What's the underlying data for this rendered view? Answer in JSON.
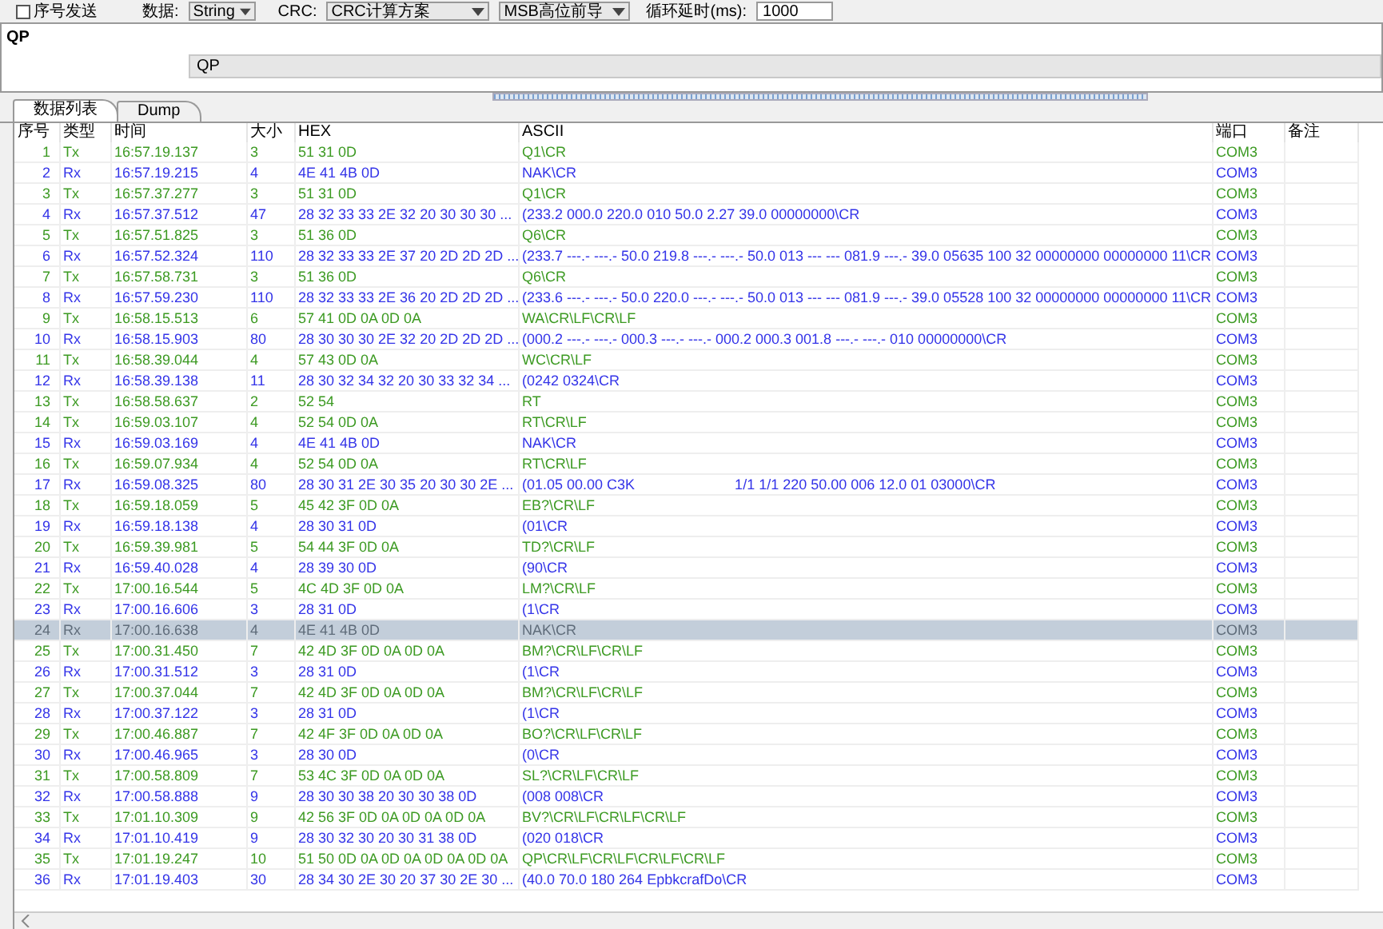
{
  "toolbar": {
    "sequence_send": {
      "label": "序号发送",
      "checked": false
    },
    "data_label": "数据:",
    "data_format": "String",
    "crc_label": "CRC:",
    "crc_scheme": "CRC计算方案",
    "bit_order": "MSB高位前导",
    "loop_delay_label": "循环延时(ms):",
    "loop_delay": "1000"
  },
  "send_panel": {
    "text": "QP",
    "history": "QP"
  },
  "tabs": [
    {
      "label": "数据列表",
      "selected": true
    },
    {
      "label": "Dump",
      "selected": false
    }
  ],
  "table": {
    "columns": [
      "序号",
      "类型",
      "时间",
      "大小",
      "HEX",
      "ASCII",
      "端口",
      "备注"
    ],
    "rows": [
      {
        "kind": "tx",
        "selected": false,
        "cells": [
          "1",
          "Tx",
          "16:57.19.137",
          "3",
          "51 31 0D",
          "Q1\\CR",
          "COM3"
        ]
      },
      {
        "kind": "rx",
        "selected": false,
        "cells": [
          "2",
          "Rx",
          "16:57.19.215",
          "4",
          "4E 41 4B 0D",
          "NAK\\CR",
          "COM3"
        ]
      },
      {
        "kind": "tx",
        "selected": false,
        "cells": [
          "3",
          "Tx",
          "16:57.37.277",
          "3",
          "51 31 0D",
          "Q1\\CR",
          "COM3"
        ]
      },
      {
        "kind": "rx",
        "selected": false,
        "cells": [
          "4",
          "Rx",
          "16:57.37.512",
          "47",
          "28 32 33 33 2E 32 20 30 30 30 ...",
          "(233.2 000.0 220.0 010 50.0 2.27 39.0 00000000\\CR",
          "COM3"
        ]
      },
      {
        "kind": "tx",
        "selected": false,
        "cells": [
          "5",
          "Tx",
          "16:57.51.825",
          "3",
          "51 36 0D",
          "Q6\\CR",
          "COM3"
        ]
      },
      {
        "kind": "rx",
        "selected": false,
        "cells": [
          "6",
          "Rx",
          "16:57.52.324",
          "110",
          "28 32 33 33 2E 37 20 2D 2D 2D ...",
          "(233.7 ---.- ---.- 50.0 219.8 ---.- ---.- 50.0 013 --- --- 081.9 ---.- 39.0 05635 100 32 00000000 00000000 11\\CR",
          "COM3"
        ]
      },
      {
        "kind": "tx",
        "selected": false,
        "cells": [
          "7",
          "Tx",
          "16:57.58.731",
          "3",
          "51 36 0D",
          "Q6\\CR",
          "COM3"
        ]
      },
      {
        "kind": "rx",
        "selected": false,
        "cells": [
          "8",
          "Rx",
          "16:57.59.230",
          "110",
          "28 32 33 33 2E 36 20 2D 2D 2D ...",
          "(233.6 ---.- ---.- 50.0 220.0 ---.- ---.- 50.0 013 --- --- 081.9 ---.- 39.0 05528 100 32 00000000 00000000 11\\CR",
          "COM3"
        ]
      },
      {
        "kind": "tx",
        "selected": false,
        "cells": [
          "9",
          "Tx",
          "16:58.15.513",
          "6",
          "57 41 0D 0A 0D 0A",
          "WA\\CR\\LF\\CR\\LF",
          "COM3"
        ]
      },
      {
        "kind": "rx",
        "selected": false,
        "cells": [
          "10",
          "Rx",
          "16:58.15.903",
          "80",
          "28 30 30 30 2E 32 20 2D 2D 2D ...",
          "(000.2 ---.- ---.- 000.3 ---.- ---.- 000.2 000.3 001.8 ---.- ---.- 010 00000000\\CR",
          "COM3"
        ]
      },
      {
        "kind": "tx",
        "selected": false,
        "cells": [
          "11",
          "Tx",
          "16:58.39.044",
          "4",
          "57 43 0D 0A",
          "WC\\CR\\LF",
          "COM3"
        ]
      },
      {
        "kind": "rx",
        "selected": false,
        "cells": [
          "12",
          "Rx",
          "16:58.39.138",
          "11",
          "28 30 32 34 32 20 30 33 32 34 ...",
          "(0242 0324\\CR",
          "COM3"
        ]
      },
      {
        "kind": "tx",
        "selected": false,
        "cells": [
          "13",
          "Tx",
          "16:58.58.637",
          "2",
          "52 54",
          "RT",
          "COM3"
        ]
      },
      {
        "kind": "tx",
        "selected": false,
        "cells": [
          "14",
          "Tx",
          "16:59.03.107",
          "4",
          "52 54 0D 0A",
          "RT\\CR\\LF",
          "COM3"
        ]
      },
      {
        "kind": "rx",
        "selected": false,
        "cells": [
          "15",
          "Rx",
          "16:59.03.169",
          "4",
          "4E 41 4B 0D",
          "NAK\\CR",
          "COM3"
        ]
      },
      {
        "kind": "tx",
        "selected": false,
        "cells": [
          "16",
          "Tx",
          "16:59.07.934",
          "4",
          "52 54 0D 0A",
          "RT\\CR\\LF",
          "COM3"
        ]
      },
      {
        "kind": "rx",
        "selected": false,
        "cells": [
          "17",
          "Rx",
          "16:59.08.325",
          "80",
          "28 30 31 2E 30 35 20 30 30 2E ...",
          "(01.05 00.00 C3K                         1/1 1/1 220 50.00 006 12.0 01 03000\\CR",
          "COM3"
        ]
      },
      {
        "kind": "tx",
        "selected": false,
        "cells": [
          "18",
          "Tx",
          "16:59.18.059",
          "5",
          "45 42 3F 0D 0A",
          "EB?\\CR\\LF",
          "COM3"
        ]
      },
      {
        "kind": "rx",
        "selected": false,
        "cells": [
          "19",
          "Rx",
          "16:59.18.138",
          "4",
          "28 30 31 0D",
          "(01\\CR",
          "COM3"
        ]
      },
      {
        "kind": "tx",
        "selected": false,
        "cells": [
          "20",
          "Tx",
          "16:59.39.981",
          "5",
          "54 44 3F 0D 0A",
          "TD?\\CR\\LF",
          "COM3"
        ]
      },
      {
        "kind": "rx",
        "selected": false,
        "cells": [
          "21",
          "Rx",
          "16:59.40.028",
          "4",
          "28 39 30 0D",
          "(90\\CR",
          "COM3"
        ]
      },
      {
        "kind": "tx",
        "selected": false,
        "cells": [
          "22",
          "Tx",
          "17:00.16.544",
          "5",
          "4C 4D 3F 0D 0A",
          "LM?\\CR\\LF",
          "COM3"
        ]
      },
      {
        "kind": "rx",
        "selected": false,
        "cells": [
          "23",
          "Rx",
          "17:00.16.606",
          "3",
          "28 31 0D",
          "(1\\CR",
          "COM3"
        ]
      },
      {
        "kind": "rx",
        "selected": true,
        "cells": [
          "24",
          "Rx",
          "17:00.16.638",
          "4",
          "4E 41 4B 0D",
          "NAK\\CR",
          "COM3"
        ]
      },
      {
        "kind": "tx",
        "selected": false,
        "cells": [
          "25",
          "Tx",
          "17:00.31.450",
          "7",
          "42 4D 3F 0D 0A 0D 0A",
          "BM?\\CR\\LF\\CR\\LF",
          "COM3"
        ]
      },
      {
        "kind": "rx",
        "selected": false,
        "cells": [
          "26",
          "Rx",
          "17:00.31.512",
          "3",
          "28 31 0D",
          "(1\\CR",
          "COM3"
        ]
      },
      {
        "kind": "tx",
        "selected": false,
        "cells": [
          "27",
          "Tx",
          "17:00.37.044",
          "7",
          "42 4D 3F 0D 0A 0D 0A",
          "BM?\\CR\\LF\\CR\\LF",
          "COM3"
        ]
      },
      {
        "kind": "rx",
        "selected": false,
        "cells": [
          "28",
          "Rx",
          "17:00.37.122",
          "3",
          "28 31 0D",
          "(1\\CR",
          "COM3"
        ]
      },
      {
        "kind": "tx",
        "selected": false,
        "cells": [
          "29",
          "Tx",
          "17:00.46.887",
          "7",
          "42 4F 3F 0D 0A 0D 0A",
          "BO?\\CR\\LF\\CR\\LF",
          "COM3"
        ]
      },
      {
        "kind": "rx",
        "selected": false,
        "cells": [
          "30",
          "Rx",
          "17:00.46.965",
          "3",
          "28 30 0D",
          "(0\\CR",
          "COM3"
        ]
      },
      {
        "kind": "tx",
        "selected": false,
        "cells": [
          "31",
          "Tx",
          "17:00.58.809",
          "7",
          "53 4C 3F 0D 0A 0D 0A",
          "SL?\\CR\\LF\\CR\\LF",
          "COM3"
        ]
      },
      {
        "kind": "rx",
        "selected": false,
        "cells": [
          "32",
          "Rx",
          "17:00.58.888",
          "9",
          "28 30 30 38 20 30 30 38 0D",
          "(008 008\\CR",
          "COM3"
        ]
      },
      {
        "kind": "tx",
        "selected": false,
        "cells": [
          "33",
          "Tx",
          "17:01.10.309",
          "9",
          "42 56 3F 0D 0A 0D 0A 0D 0A",
          "BV?\\CR\\LF\\CR\\LF\\CR\\LF",
          "COM3"
        ]
      },
      {
        "kind": "rx",
        "selected": false,
        "cells": [
          "34",
          "Rx",
          "17:01.10.419",
          "9",
          "28 30 32 30 20 30 31 38 0D",
          "(020 018\\CR",
          "COM3"
        ]
      },
      {
        "kind": "tx",
        "selected": false,
        "cells": [
          "35",
          "Tx",
          "17:01.19.247",
          "10",
          "51 50 0D 0A 0D 0A 0D 0A 0D 0A",
          "QP\\CR\\LF\\CR\\LF\\CR\\LF\\CR\\LF",
          "COM3"
        ]
      },
      {
        "kind": "rx",
        "selected": false,
        "cells": [
          "36",
          "Rx",
          "17:01.19.403",
          "30",
          "28 34 30 2E 30 20 37 30 2E 30 ...",
          "(40.0 70.0 180 264 EpbkcrafDo\\CR",
          "COM3"
        ]
      }
    ]
  }
}
